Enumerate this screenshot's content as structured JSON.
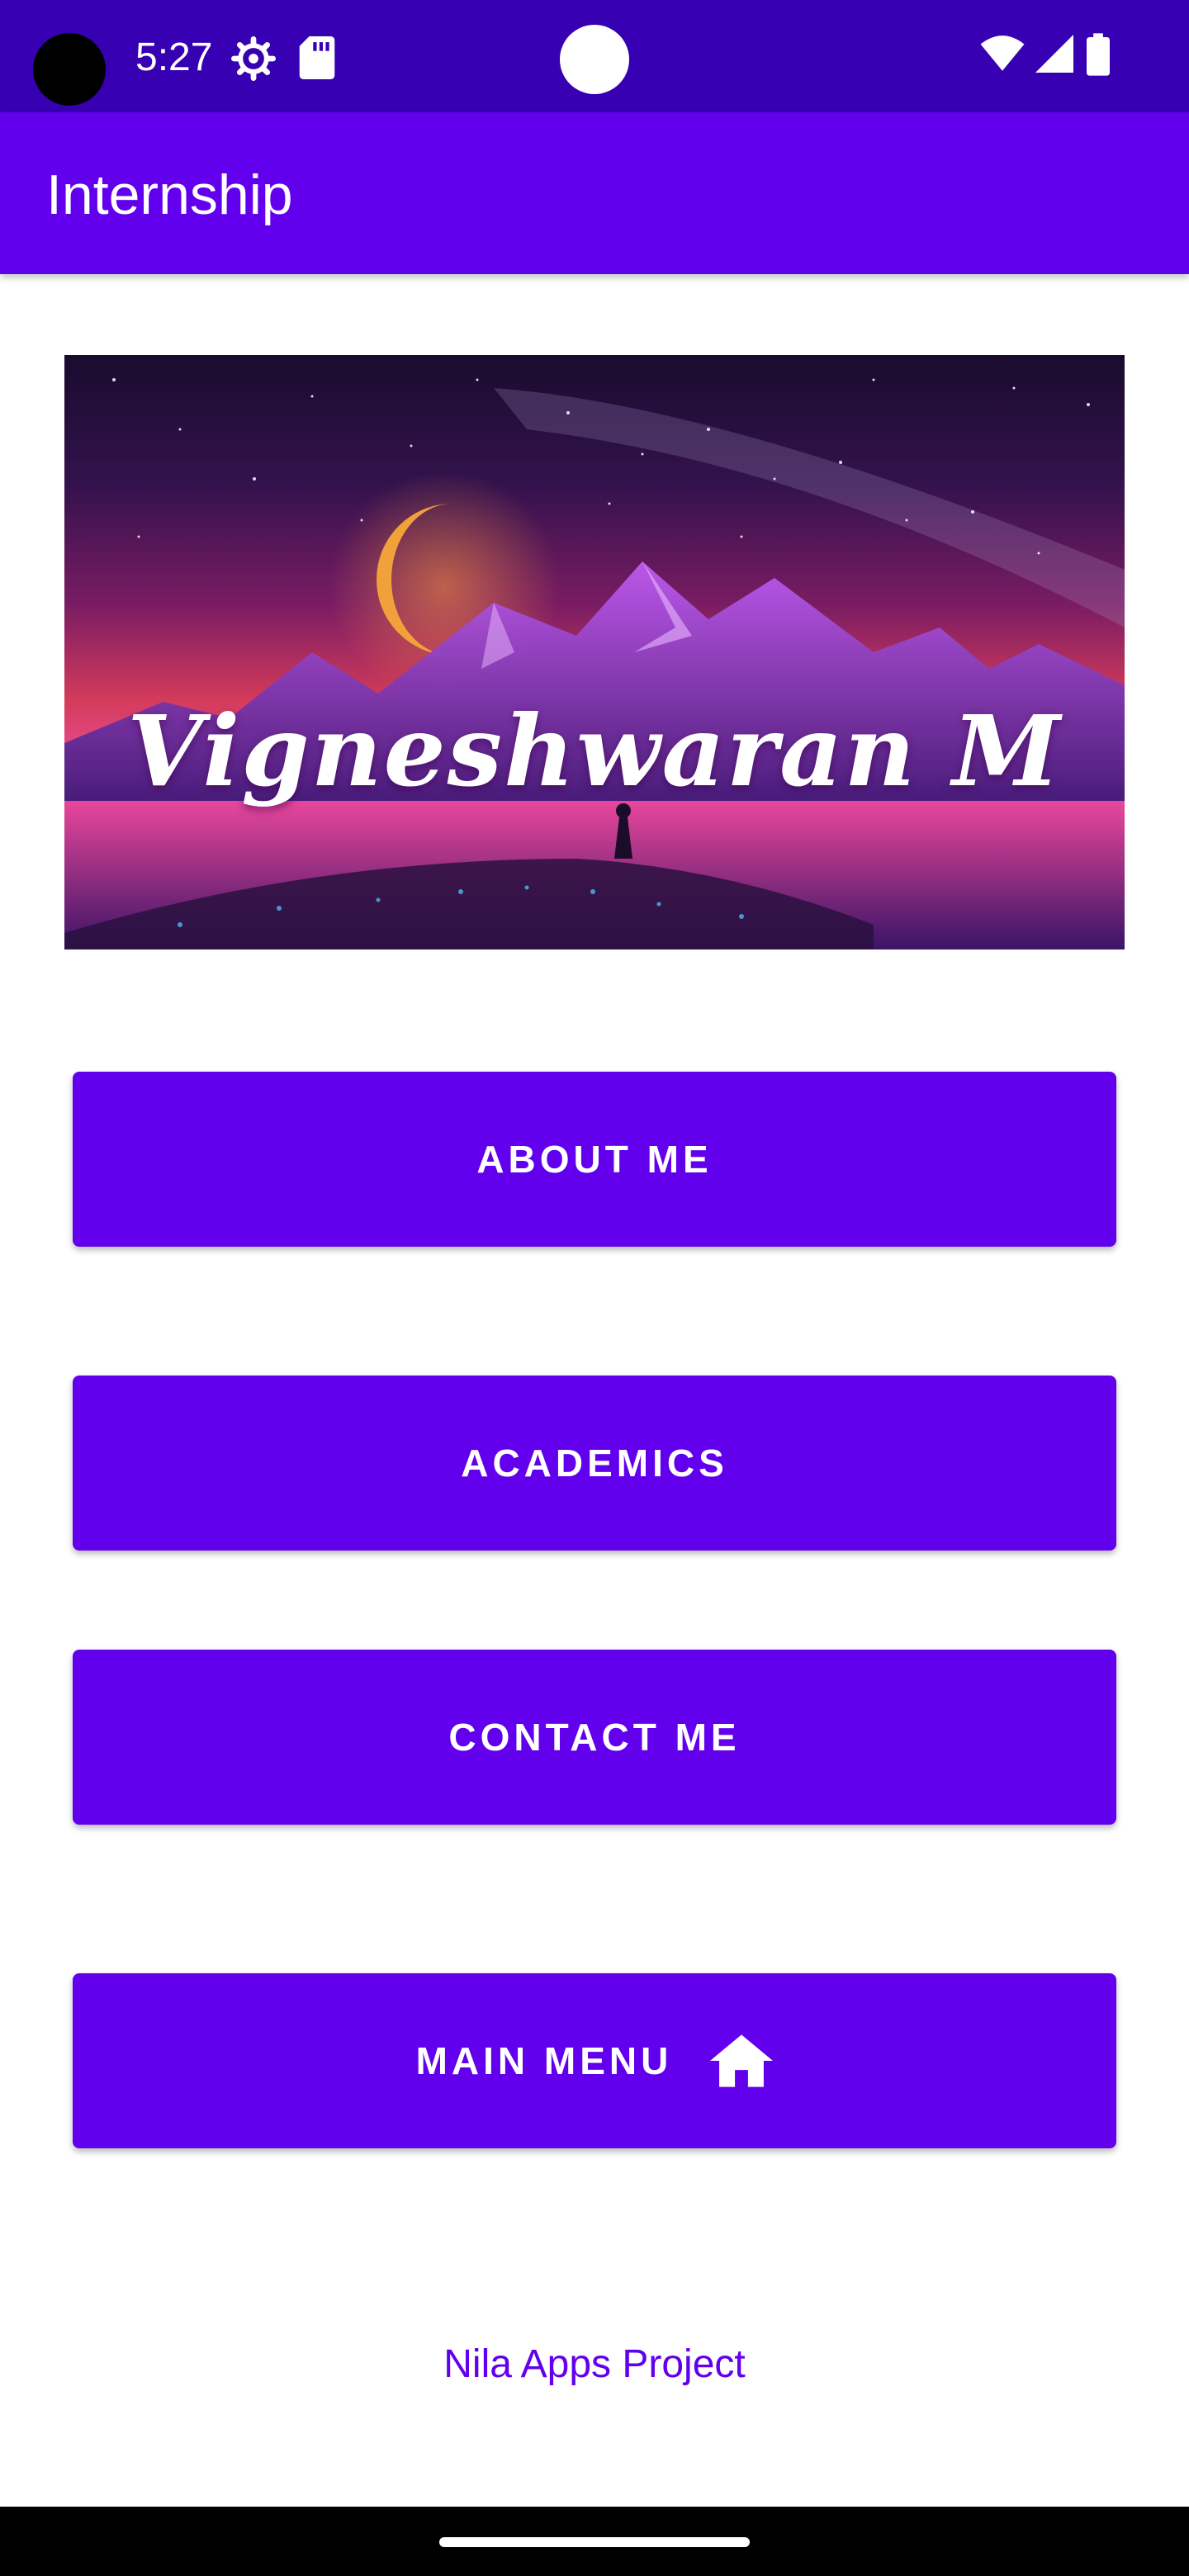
{
  "status_bar": {
    "time": "5:27",
    "icons": [
      "settings-icon",
      "sd-card-icon",
      "wifi-icon",
      "signal-icon",
      "battery-icon"
    ],
    "background": "#3700B3"
  },
  "app_bar": {
    "title": "Internship",
    "background": "#6200EE"
  },
  "banner": {
    "name": "Vigneshwaran M"
  },
  "buttons": {
    "about": "ABOUT ME",
    "academics": "ACADEMICS",
    "contact": "CONTACT ME",
    "main_menu": "MAIN MENU",
    "main_menu_icon": "home-icon",
    "color": "#6200EE"
  },
  "footer": {
    "text": "Nila Apps Project"
  }
}
